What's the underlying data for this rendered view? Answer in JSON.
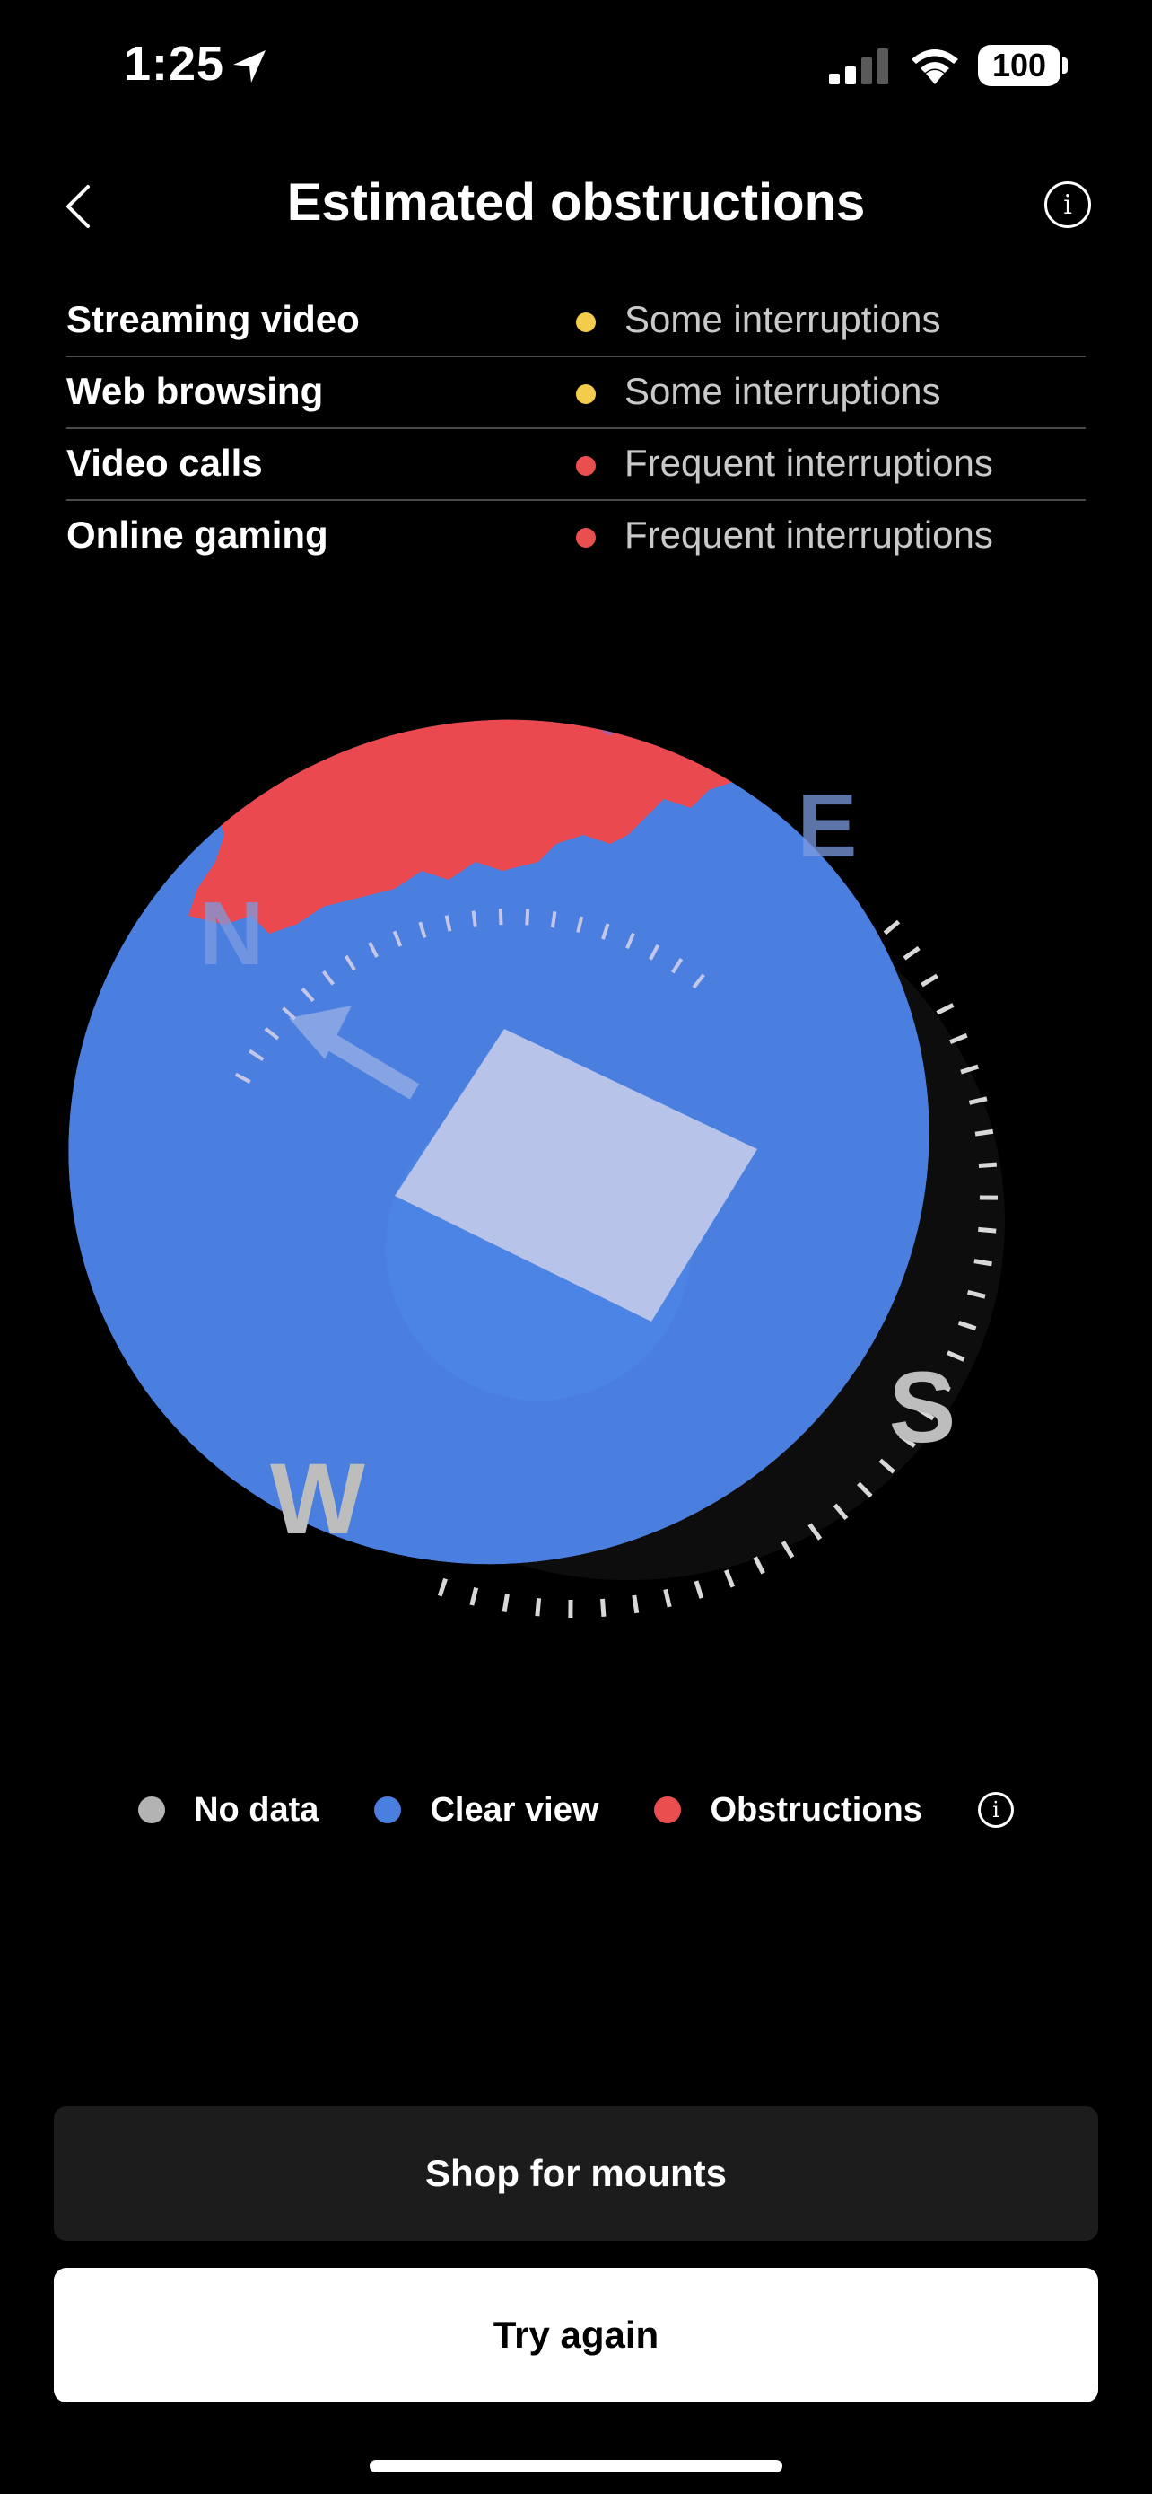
{
  "status_bar": {
    "time": "1:25",
    "battery": "100",
    "icons": [
      "location-arrow-icon",
      "cellular-signal-icon",
      "wifi-icon",
      "battery-icon"
    ]
  },
  "header": {
    "title": "Estimated obstructions",
    "back_icon": "chevron-left-icon",
    "info_icon": "info-icon",
    "info_glyph": "i"
  },
  "usage": [
    {
      "activity": "Streaming video",
      "status": "Some interruptions",
      "level": "some"
    },
    {
      "activity": "Web browsing",
      "status": "Some interruptions",
      "level": "some"
    },
    {
      "activity": "Video calls",
      "status": "Frequent interruptions",
      "level": "frequent"
    },
    {
      "activity": "Online gaming",
      "status": "Frequent interruptions",
      "level": "frequent"
    }
  ],
  "compass": {
    "n": "N",
    "e": "E",
    "s": "S",
    "w": "W"
  },
  "legend": [
    {
      "label": "No data",
      "color": "#b3b3b3"
    },
    {
      "label": "Clear view",
      "color": "#4a7fe0"
    },
    {
      "label": "Obstructions",
      "color": "#ea4f4f"
    }
  ],
  "legend_info_glyph": "i",
  "colors": {
    "some": "#f3cc4c",
    "frequent": "#ea4f4f",
    "clear": "#4a7fe0",
    "obstruction": "#ea4a4f",
    "dish": "#b7c3e8"
  },
  "buttons": {
    "shop": "Shop for mounts",
    "retry": "Try again"
  }
}
